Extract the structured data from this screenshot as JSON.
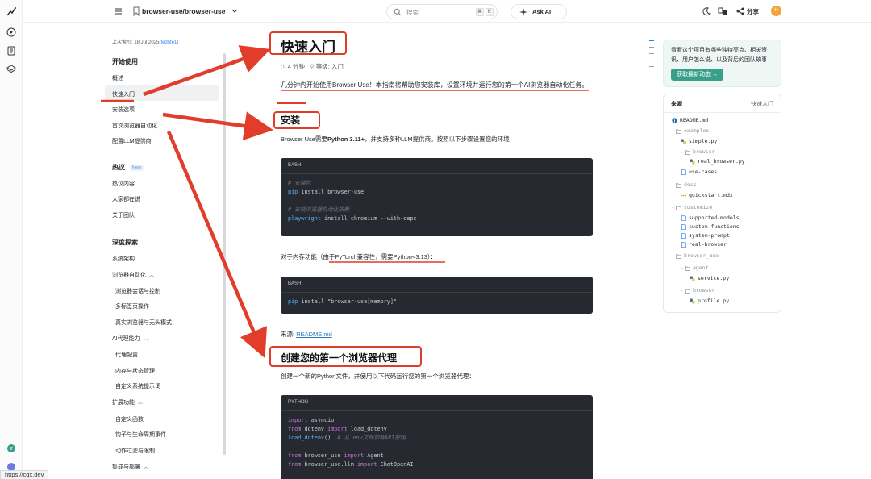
{
  "topbar": {
    "repo_title": "browser-use/browser-use",
    "search_placeholder": "搜索",
    "kbd_cmd": "⌘",
    "kbd_k": "K",
    "ask_ai_label": "Ask AI",
    "share_label": "分享",
    "avatar_initial": "H"
  },
  "sidebar": {
    "last_indexed_prefix": "上次索引: 18 Jul 2025",
    "last_indexed_hash": "(fed5fe1)",
    "sections": [
      {
        "title": "开始使用",
        "items": [
          "概述",
          "快速入门",
          "安装选项",
          "首次浏览器自动化",
          "配置LLM提供商"
        ]
      },
      {
        "title": "热议",
        "badge": "New",
        "items": [
          "热议内容",
          "大家都在说",
          "关于团队"
        ]
      },
      {
        "title": "深度探索",
        "items": [
          "系统架构",
          "浏览器自动化",
          "浏览器会话与控制",
          "多标签页操作",
          "真实浏览器与无头模式",
          "AI代理能力",
          "代理配置",
          "内存与状态管理",
          "自定义系统提示词",
          "扩展功能",
          "自定义函数",
          "钩子与生命周期事件",
          "动作过滤与限制",
          "集成与部署"
        ]
      }
    ],
    "active_item": "快速入门"
  },
  "main": {
    "title": "快速入门",
    "read_time": "4 分钟",
    "level": "等级: 入门",
    "intro": "几分钟内开始使用Browser Use！本指南将帮助您安装库，设置环境并运行您的第一个AI浏览器自动化任务。",
    "install_heading": "安装",
    "install_para_pre": "Browser Use需要",
    "install_para_bold": "Python 3.11+",
    "install_para_post": "，并支持多种LLM提供商。按照以下步骤设置您的环境：",
    "code1": {
      "lang": "BASH",
      "lines": [
        {
          "cls": "cm",
          "text": "# 安装包"
        },
        {
          "parts": [
            {
              "cls": "fn",
              "text": "pip"
            },
            {
              "cls": "st",
              "text": " install browser-use"
            }
          ]
        },
        {
          "cls": "st",
          "text": ""
        },
        {
          "cls": "cm",
          "text": "# 安装浏览器自动化依赖"
        },
        {
          "parts": [
            {
              "cls": "fn",
              "text": "playwright"
            },
            {
              "cls": "st",
              "text": " install chromium --with-deps"
            }
          ]
        }
      ]
    },
    "memory_para": "对于内存功能（由于PyTorch兼容性，需要Python<3.13）：",
    "code2": {
      "lang": "BASH",
      "lines": [
        {
          "parts": [
            {
              "cls": "fn",
              "text": "pip"
            },
            {
              "cls": "st",
              "text": " install \"browser-use[memory]\""
            }
          ]
        }
      ]
    },
    "source_label": "来源:",
    "source_link": "README.md",
    "agent_heading": "创建您的第一个浏览器代理",
    "agent_para": "创建一个新的Python文件，并使用以下代码运行您的第一个浏览器代理：",
    "code3": {
      "lang": "PYTHON",
      "lines": [
        {
          "parts": [
            {
              "cls": "kw",
              "text": "import"
            },
            {
              "cls": "st",
              "text": " asyncio"
            }
          ]
        },
        {
          "parts": [
            {
              "cls": "kw",
              "text": "from"
            },
            {
              "cls": "st",
              "text": " dotenv "
            },
            {
              "cls": "kw",
              "text": "import"
            },
            {
              "cls": "st",
              "text": " load_dotenv"
            }
          ]
        },
        {
          "parts": [
            {
              "cls": "fn",
              "text": "load_dotenv"
            },
            {
              "cls": "st",
              "text": "()  "
            },
            {
              "cls": "cm",
              "text": "# 从.env文件加载API密钥"
            }
          ]
        },
        {
          "cls": "st",
          "text": ""
        },
        {
          "parts": [
            {
              "cls": "kw",
              "text": "from"
            },
            {
              "cls": "st",
              "text": " browser_use "
            },
            {
              "cls": "kw",
              "text": "import"
            },
            {
              "cls": "st",
              "text": " Agent"
            }
          ]
        },
        {
          "parts": [
            {
              "cls": "kw",
              "text": "from"
            },
            {
              "cls": "st",
              "text": " browser_use.llm "
            },
            {
              "cls": "kw",
              "text": "import"
            },
            {
              "cls": "st",
              "text": " ChatOpenAI"
            }
          ]
        }
      ]
    }
  },
  "right": {
    "promo_text": "看看这个项目有哪些独特亮点、相关资讯、用户怎么说、以及背后的团队故事",
    "promo_button": "获取最新动态 →",
    "sources_title": "来源",
    "sources_link": "快速入门",
    "tree": [
      {
        "name": "README.md",
        "type": "info",
        "indent": 0
      },
      {
        "name": "examples",
        "type": "dir",
        "indent": 0
      },
      {
        "name": "simple.py",
        "type": "py",
        "indent": 1
      },
      {
        "name": "browser",
        "type": "dir",
        "indent": 1
      },
      {
        "name": "real_browser.py",
        "type": "py",
        "indent": 2
      },
      {
        "name": "use-cases",
        "type": "file",
        "indent": 1
      },
      {
        "name": "docs",
        "type": "dir",
        "indent": 0
      },
      {
        "name": "quickstart.mdx",
        "type": "mdx",
        "indent": 1
      },
      {
        "name": "customize",
        "type": "dir",
        "indent": 0
      },
      {
        "name": "supported-models",
        "type": "file",
        "indent": 1
      },
      {
        "name": "custom-functions",
        "type": "file",
        "indent": 1
      },
      {
        "name": "system-prompt",
        "type": "file",
        "indent": 1
      },
      {
        "name": "real-browser",
        "type": "file",
        "indent": 1
      },
      {
        "name": "browser_use",
        "type": "dir",
        "indent": 0
      },
      {
        "name": "agent",
        "type": "dir",
        "indent": 1
      },
      {
        "name": "service.py",
        "type": "py",
        "indent": 2
      },
      {
        "name": "browser",
        "type": "dir",
        "indent": 1
      },
      {
        "name": "profile.py",
        "type": "py",
        "indent": 2
      }
    ]
  },
  "status_url": "https://cqx.dev",
  "colors": {
    "annotation_red": "#e23d2a",
    "accent_teal": "#3a9f8a",
    "link_blue": "#2a7ab8"
  }
}
